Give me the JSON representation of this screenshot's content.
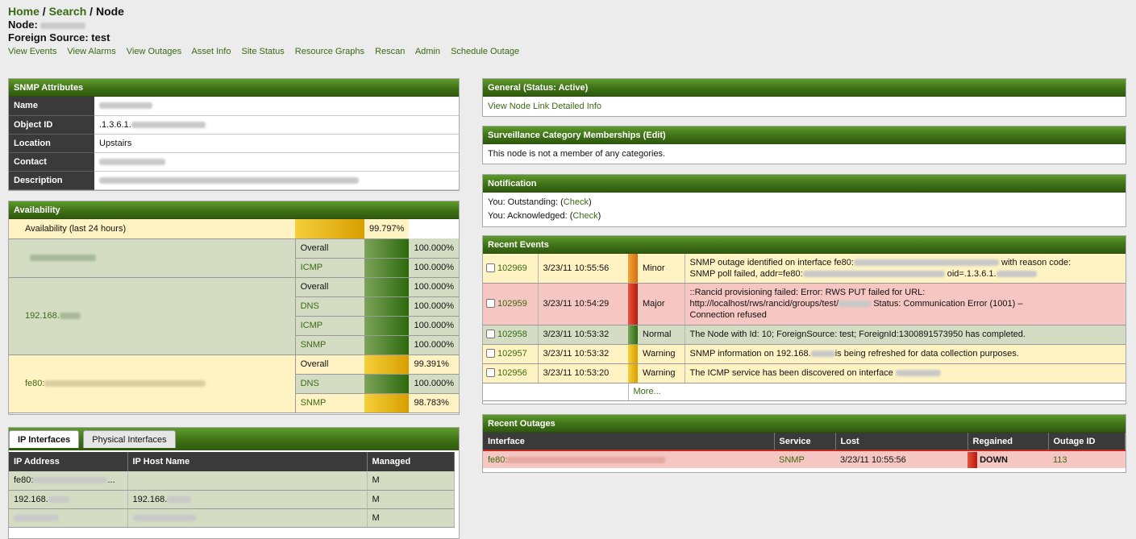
{
  "breadcrumb": {
    "home": "Home",
    "search": "Search",
    "node": "Node",
    "sep": "/"
  },
  "node_label": "Node:",
  "foreign_source": "Foreign Source: test",
  "nav_links": [
    "View Events",
    "View Alarms",
    "View Outages",
    "Asset Info",
    "Site Status",
    "Resource Graphs",
    "Rescan",
    "Admin",
    "Schedule Outage"
  ],
  "snmp": {
    "title": "SNMP Attributes",
    "rows": [
      {
        "key": "Name",
        "value": ""
      },
      {
        "key": "Object ID",
        "value": ".1.3.6.1."
      },
      {
        "key": "Location",
        "value": "Upstairs"
      },
      {
        "key": "Contact",
        "value": ""
      },
      {
        "key": "Description",
        "value": ""
      }
    ]
  },
  "availability": {
    "title": "Availability",
    "summary_label": "Availability (last 24 hours)",
    "summary_value": "99.797%",
    "ip2": "192.168.",
    "ip3": "fe80:",
    "services": [
      {
        "name": "Overall",
        "value": "100.000%"
      },
      {
        "name": "ICMP",
        "value": "100.000%"
      },
      {
        "name": "Overall",
        "value": "100.000%"
      },
      {
        "name": "DNS",
        "value": "100.000%"
      },
      {
        "name": "ICMP",
        "value": "100.000%"
      },
      {
        "name": "SNMP",
        "value": "100.000%"
      },
      {
        "name": "Overall",
        "value": "99.391%"
      },
      {
        "name": "DNS",
        "value": "100.000%"
      },
      {
        "name": "SNMP",
        "value": "98.783%"
      }
    ]
  },
  "interfaces": {
    "tabs": [
      "IP Interfaces",
      "Physical Interfaces"
    ],
    "columns": [
      "IP Address",
      "IP Host Name",
      "Managed"
    ],
    "rows": [
      {
        "ip": "fe80:",
        "ip_tail": "...",
        "host": "",
        "managed": "M"
      },
      {
        "ip": "192.168.",
        "host": "192.168.",
        "managed": "M"
      },
      {
        "ip": "",
        "host": "",
        "managed": "M"
      }
    ]
  },
  "general": {
    "title": "General (Status: Active)",
    "link": "View Node Link Detailed Info"
  },
  "surveillance": {
    "title": "Surveillance Category Memberships (Edit)",
    "text": "This node is not a member of any categories."
  },
  "notification": {
    "title": "Notification",
    "outstanding": "You: Outstanding: (",
    "acknowledged": "You: Acknowledged: (",
    "check": "Check",
    "close": ")"
  },
  "events": {
    "title": "Recent Events",
    "rows": [
      {
        "id": "102969",
        "time": "3/23/11 10:55:56",
        "severity": "Minor",
        "msg1": "SNMP outage identified on interface fe80:",
        "msg1b": "with reason code:",
        "msg2": "SNMP poll failed, addr=fe80:",
        "msg2b": "oid=.1.3.6.1."
      },
      {
        "id": "102959",
        "time": "3/23/11 10:54:29",
        "severity": "Major",
        "msg1": "::Rancid provisioning failed: Error: RWS PUT failed for URL:",
        "msg2": "http://localhost/rws/rancid/groups/test/",
        "msg2b": "Status: Communication Error (1001) –",
        "msg3": "Connection refused"
      },
      {
        "id": "102958",
        "time": "3/23/11 10:53:32",
        "severity": "Normal",
        "msg1": "The Node with Id: 10; ForeignSource: test; ForeignId:1300891573950 has completed."
      },
      {
        "id": "102957",
        "time": "3/23/11 10:53:32",
        "severity": "Warning",
        "msg1": "SNMP information on 192.168.",
        "msg1b": "is being refreshed for data collection purposes."
      },
      {
        "id": "102956",
        "time": "3/23/11 10:53:20",
        "severity": "Warning",
        "msg1": "The ICMP service has been discovered on interface"
      }
    ],
    "more": "More..."
  },
  "outages": {
    "title": "Recent Outages",
    "columns": [
      "Interface",
      "Service",
      "Lost",
      "Regained",
      "Outage ID"
    ],
    "row": {
      "interface": "fe80:",
      "service": "SNMP",
      "lost": "3/23/11 10:55:56",
      "regained": "DOWN",
      "id": "113"
    }
  },
  "colors": {
    "accent": "#3f7116",
    "link": "#3a6a12",
    "normal": "#d4ddc4",
    "warning": "#fff3c4",
    "critical": "#f6c6c2"
  }
}
